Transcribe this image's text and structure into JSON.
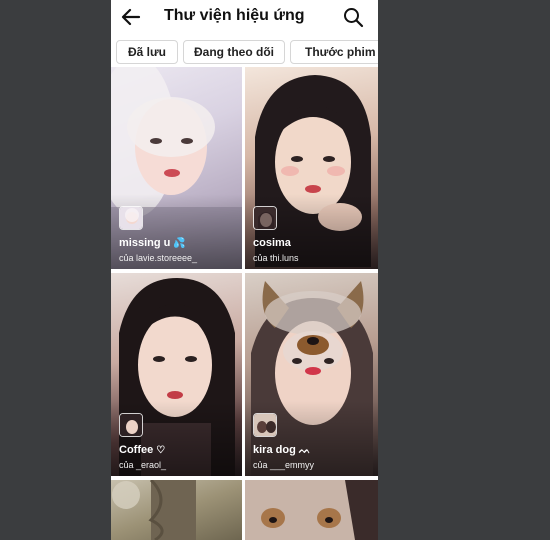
{
  "header": {
    "title": "Thư viện hiệu ứng",
    "back_icon": "back-arrow-icon",
    "search_icon": "search-icon"
  },
  "tabs": [
    {
      "label": "Đã lưu"
    },
    {
      "label": "Đang theo dõi"
    },
    {
      "label": "Thước phim"
    }
  ],
  "effects": [
    {
      "name": "missing u",
      "name_icon": "💦",
      "author": "của lavie.storeeee_"
    },
    {
      "name": "cosima",
      "author": "của thi.luns"
    },
    {
      "name": "Coffee",
      "name_icon": "♡",
      "author": "của _eraol_"
    },
    {
      "name": "kira dog",
      "name_icon": "ᨓ",
      "author": "của ___emmyy"
    }
  ],
  "colors": {
    "backdrop": "#3b3d3f",
    "screen": "#ffffff",
    "tab_border": "#d6d6d6",
    "title": "#111111"
  }
}
